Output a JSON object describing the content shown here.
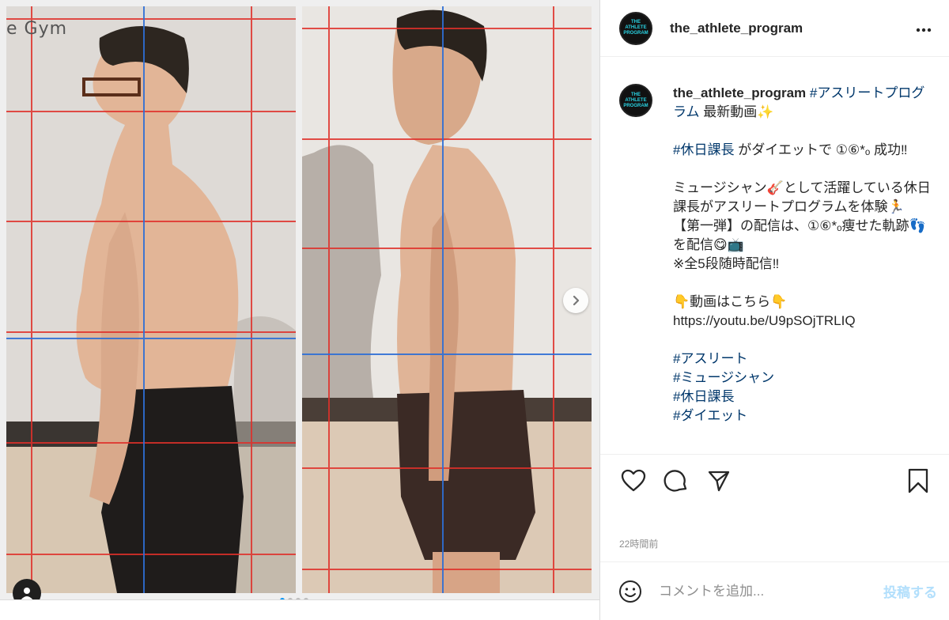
{
  "account": {
    "username": "the_athlete_program",
    "avatar_text": [
      "THE",
      "ATHLETE",
      "PROGRAM"
    ]
  },
  "media": {
    "gym_text": "e Gym",
    "slide_count": 4,
    "active_slide": 1
  },
  "caption": {
    "username": "the_athlete_program",
    "hashtag_title": "#アスリートプログラム",
    "title_rest": " 最新動画✨",
    "line2_tag": "#休日課長",
    "line2_rest": " がダイエットで ①⑥*ₒ 成功‼",
    "para2": "ミュージシャン🎸として活躍している休日課長がアスリートプログラムを体験🏃",
    "para3": "【第一弾】の配信は、①⑥*ₒ痩せた軌跡👣を配信😋📺",
    "para4": "※全5段随時配信‼",
    "link_intro": "👇動画はこちら👇",
    "link": "https://youtu.be/U9pSOjTRLIQ",
    "tags": [
      "#アスリート",
      "#ミュージシャン",
      "#休日課長",
      "#ダイエット"
    ]
  },
  "meta": {
    "timestamp": "22時間前"
  },
  "comment": {
    "placeholder": "コメントを追加...",
    "post_label": "投稿する"
  },
  "icons": {
    "more": "more-icon",
    "like": "heart-icon",
    "comment": "comment-icon",
    "share": "send-icon",
    "save": "bookmark-icon",
    "emoji": "emoji-icon",
    "next": "chevron-right-icon",
    "tag": "user-tag-icon"
  },
  "colors": {
    "link": "#00376b",
    "post_button": "#b2dffc",
    "active_dot": "#0095f6"
  }
}
